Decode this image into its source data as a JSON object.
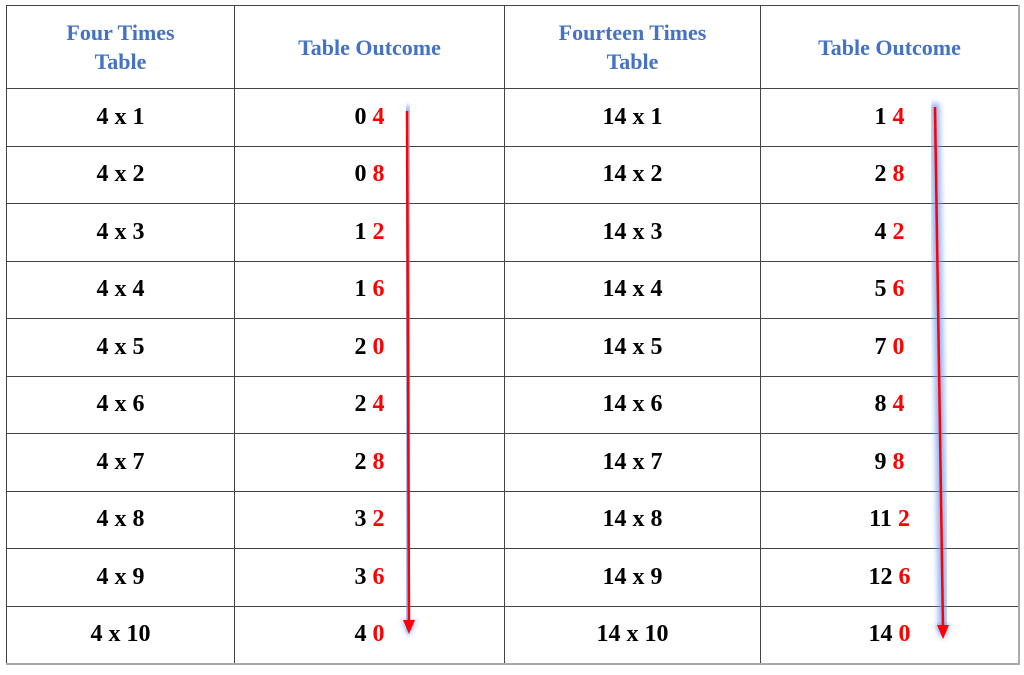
{
  "table": {
    "headers": [
      "Four Times Table",
      "Table Outcome",
      "Fourteen Times Table",
      "Table Outcome"
    ],
    "header_lines": [
      [
        "Four Times",
        "Table"
      ],
      [
        "Table Outcome"
      ],
      [
        "Fourteen Times",
        "Table"
      ],
      [
        "Table Outcome"
      ]
    ],
    "rows": [
      {
        "four": "4 x 1",
        "four_lead": "0",
        "four_last": "4",
        "fourteen": "14 x 1",
        "fourteen_lead": "1",
        "fourteen_last": "4"
      },
      {
        "four": "4 x 2",
        "four_lead": "0",
        "four_last": "8",
        "fourteen": "14 x 2",
        "fourteen_lead": "2",
        "fourteen_last": "8"
      },
      {
        "four": "4 x 3",
        "four_lead": "1",
        "four_last": "2",
        "fourteen": "14 x 3",
        "fourteen_lead": "4",
        "fourteen_last": "2"
      },
      {
        "four": "4 x 4",
        "four_lead": "1",
        "four_last": "6",
        "fourteen": "14 x 4",
        "fourteen_lead": "5",
        "fourteen_last": "6"
      },
      {
        "four": "4 x 5",
        "four_lead": "2",
        "four_last": "0",
        "fourteen": "14 x 5",
        "fourteen_lead": "7",
        "fourteen_last": "0"
      },
      {
        "four": "4 x 6",
        "four_lead": "2",
        "four_last": "4",
        "fourteen": "14 x 6",
        "fourteen_lead": "8",
        "fourteen_last": "4"
      },
      {
        "four": "4 x 7",
        "four_lead": "2",
        "four_last": "8",
        "fourteen": "14 x 7",
        "fourteen_lead": "9",
        "fourteen_last": "8"
      },
      {
        "four": "4 x 8",
        "four_lead": "3",
        "four_last": "2",
        "fourteen": "14 x 8",
        "fourteen_lead": "11",
        "fourteen_last": "2"
      },
      {
        "four": "4 x 9",
        "four_lead": "3",
        "four_last": "6",
        "fourteen": "14 x 9",
        "fourteen_lead": "12",
        "fourteen_last": "6"
      },
      {
        "four": "4 x 10",
        "four_lead": "4",
        "four_last": "0",
        "fourteen": "14 x 10",
        "fourteen_lead": "14",
        "fourteen_last": "0"
      }
    ]
  },
  "colors": {
    "header_text": "#4472c4",
    "last_digit": "#ff0000",
    "arrow": "#ff0000",
    "arrow_glow": "#6f9cf0"
  },
  "annotations": {
    "arrows": [
      {
        "name": "four-outcome-arrow",
        "direction": "down"
      },
      {
        "name": "fourteen-outcome-arrow",
        "direction": "down"
      }
    ]
  }
}
